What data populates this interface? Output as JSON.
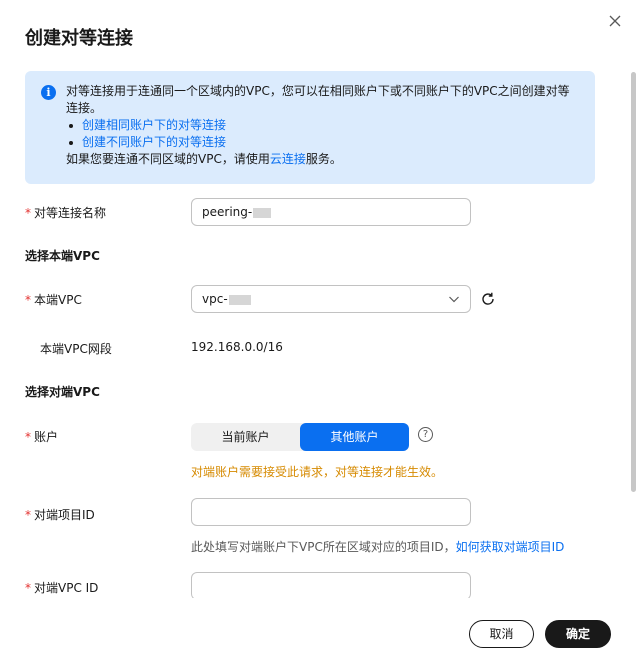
{
  "dialog": {
    "title": "创建对等连接"
  },
  "notice": {
    "line1": "对等连接用于连通同一个区域内的VPC，您可以在相同账户下或不同账户下的VPC之间创建对等连接。",
    "link1": "创建相同账户下的对等连接",
    "link2": "创建不同账户下的对等连接",
    "line4_prefix": "如果您要连通不同区域的VPC，请使用",
    "line4_link": "云连接",
    "line4_suffix": "服务。"
  },
  "form": {
    "peering_name_label": "对等连接名称",
    "peering_name_value": "peering-",
    "local_section": "选择本端VPC",
    "local_vpc_label": "本端VPC",
    "local_vpc_value": "vpc-",
    "local_cidr_label": "本端VPC网段",
    "local_cidr_value": "192.168.0.0/16",
    "peer_section": "选择对端VPC",
    "account_label": "账户",
    "account_options": [
      "当前账户",
      "其他账户"
    ],
    "account_warning": "对端账户需要接受此请求，对等连接才能生效。",
    "project_id_label": "对端项目ID",
    "project_id_value": "",
    "project_id_hint_prefix": "此处填写对端账户下VPC所在区域对应的项目ID，",
    "project_id_hint_link": "如何获取对端项目ID",
    "peer_vpc_id_label": "对端VPC ID",
    "peer_vpc_id_value": "",
    "help_mark": "?",
    "required_mark": "*"
  },
  "footer": {
    "cancel_label": "取消",
    "ok_label": "确定"
  },
  "colors": {
    "primary": "#0a6ff0",
    "notice_bg": "#dbebfd",
    "required": "#e3312f",
    "warning": "#d68a00",
    "dark_button": "#191919"
  },
  "icons": {
    "close": "close-icon",
    "info": "info-icon",
    "dropdown": "chevron-down-icon",
    "refresh": "refresh-icon",
    "help": "help-circle-icon"
  }
}
